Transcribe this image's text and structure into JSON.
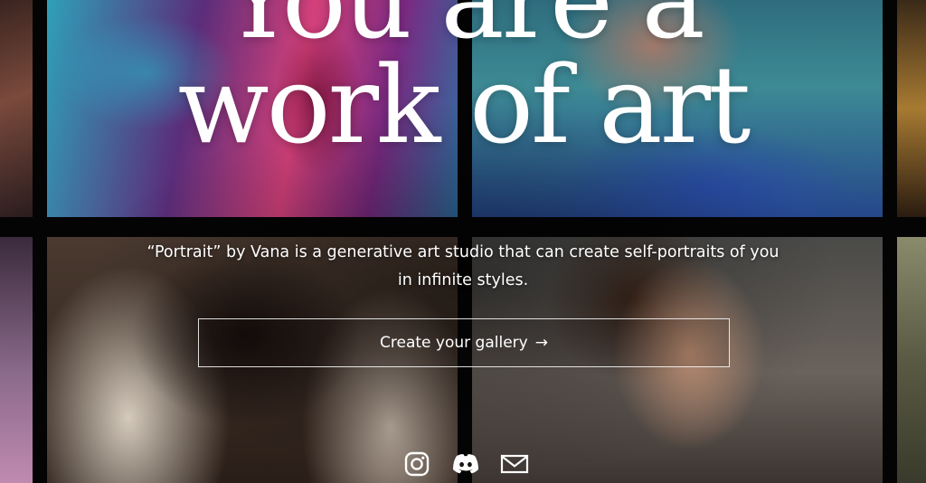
{
  "hero": {
    "headline_line1": "You are a",
    "headline_line2": "work of art",
    "subtitle": "“Portrait” by Vana is a generative art studio that can create self-portraits of you in infinite styles.",
    "cta_label": "Create your gallery",
    "cta_arrow": "→"
  },
  "socials": [
    {
      "icon": "instagram-icon"
    },
    {
      "icon": "discord-icon"
    },
    {
      "icon": "mail-icon"
    }
  ],
  "colors": {
    "text": "#ffffff",
    "background": "#050405",
    "button_border": "#ffffff"
  }
}
